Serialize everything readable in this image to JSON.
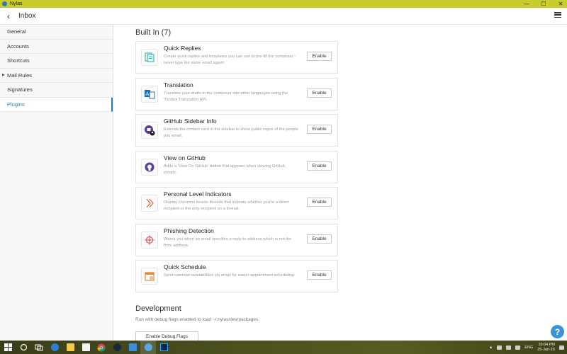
{
  "window": {
    "app_title": "Nylas",
    "minimize": "—",
    "maximize": "☐",
    "close": "✕"
  },
  "toolbar": {
    "back": "‹",
    "title": "Inbox"
  },
  "sidebar": {
    "items": [
      {
        "label": "General"
      },
      {
        "label": "Accounts"
      },
      {
        "label": "Shortcuts"
      },
      {
        "label": "Mail Rules"
      },
      {
        "label": "Signatures"
      },
      {
        "label": "Plugins"
      }
    ]
  },
  "main": {
    "builtin_title": "Built In (7)",
    "plugins": [
      {
        "name": "Quick Replies",
        "description": "Create quick replies and templates you can use to pre-fill the composer - never type the same email again!",
        "button": "Enable",
        "icon": "quick-replies-icon"
      },
      {
        "name": "Translation",
        "description": "Translate your drafts in the composer into other languages using the Yandex Translation API.",
        "button": "Enable",
        "icon": "translation-icon"
      },
      {
        "name": "GitHub Sidebar Info",
        "description": "Extends the contact card in the sidebar to show public repos of the people you email.",
        "button": "Enable",
        "icon": "github-sidebar-icon"
      },
      {
        "name": "View on GitHub",
        "description": "Adds a 'View On GitHub' button that appears when viewing GitHub emails.",
        "button": "Enable",
        "icon": "github-icon"
      },
      {
        "name": "Personal Level Indicators",
        "description": "Display chevrons beside threads that indicate whether you're a direct recipient or the only recipient on a thread.",
        "button": "Enable",
        "icon": "chevron-icon"
      },
      {
        "name": "Phishing Detection",
        "description": "Warns you when an email specifies a reply-to address which is not the from address.",
        "button": "Enable",
        "icon": "crosshair-icon"
      },
      {
        "name": "Quick Schedule",
        "description": "Send calendar availabilities via email for easier appointment scheduling.",
        "button": "Enable",
        "icon": "calendar-icon"
      }
    ],
    "dev_title": "Development",
    "dev_description": "Run with debug flags enabled to load ~/.nylas/dev/packages.",
    "debug_button": "Enable Debug Flags",
    "help": "?"
  },
  "taskbar": {
    "language": "ENG",
    "time": "10:04 PM",
    "date": "25-Jan-16"
  }
}
